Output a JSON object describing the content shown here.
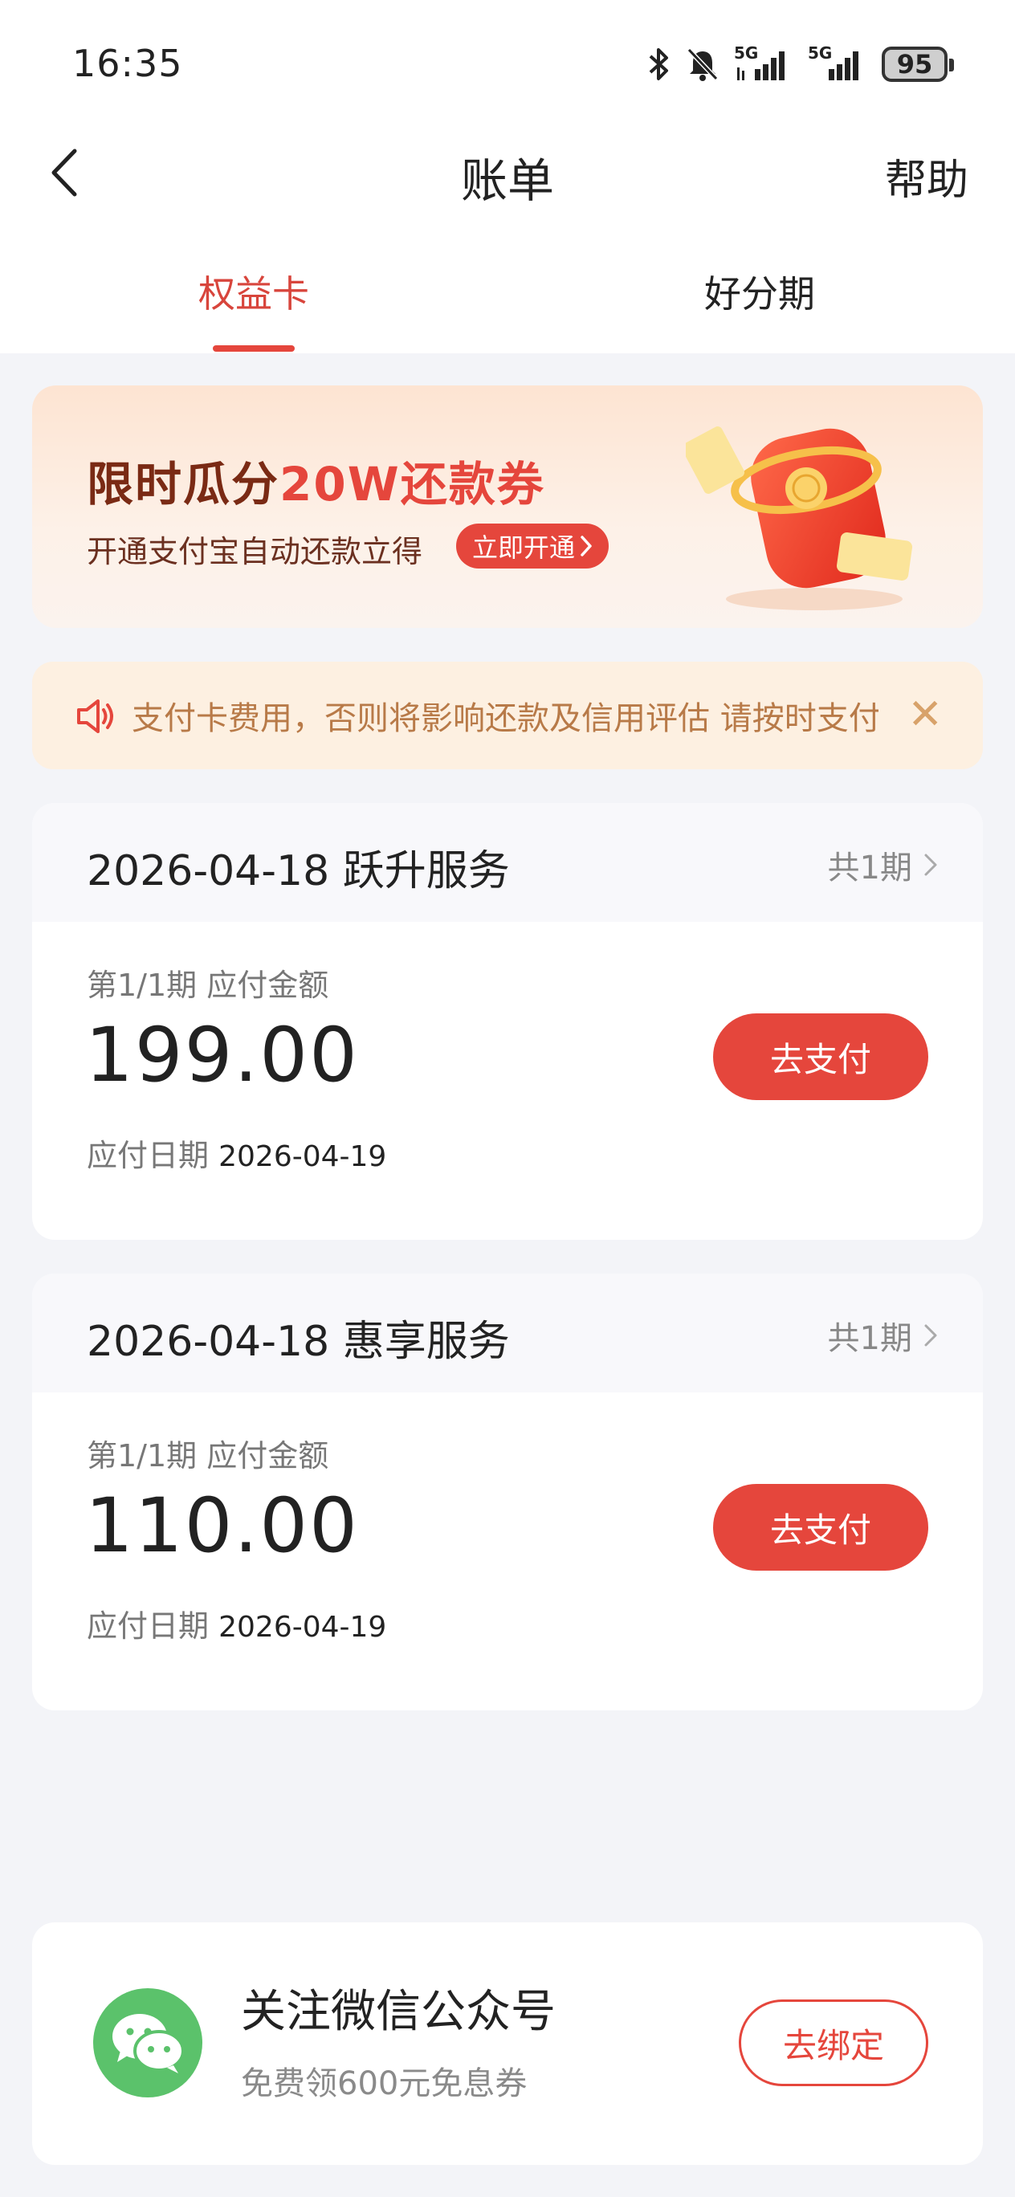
{
  "status_bar": {
    "time": "16:35",
    "network_1": "5G",
    "network_2": "5G",
    "battery": "95",
    "icons": [
      "bluetooth-icon",
      "mute-icon",
      "signal-icon",
      "signal-icon",
      "battery-icon"
    ]
  },
  "nav": {
    "title": "账单",
    "help": "帮助",
    "back_icon": "chevron-left-icon"
  },
  "tabs": [
    {
      "label": "权益卡",
      "active": true
    },
    {
      "label": "好分期",
      "active": false
    }
  ],
  "promo": {
    "title_main": "限时瓜分",
    "title_highlight": "20W还款券",
    "subtitle": "开通支付宝自动还款立得",
    "cta": "立即开通"
  },
  "notice": {
    "text": "支付卡费用，否则将影响还款及信用评估        请按时支付",
    "icon": "speaker-icon",
    "close_icon": "close-icon"
  },
  "bills": [
    {
      "title": "2026-04-18 跃升服务",
      "periods": "共1期",
      "label": "第1/1期 应付金额",
      "amount": "199.00",
      "due_label": "应付日期",
      "due_date": "2026-04-19",
      "pay_label": "去支付"
    },
    {
      "title": "2026-04-18 惠享服务",
      "periods": "共1期",
      "label": "第1/1期 应付金额",
      "amount": "110.00",
      "due_label": "应付日期",
      "due_date": "2026-04-19",
      "pay_label": "去支付"
    }
  ],
  "wechat": {
    "title": "关注微信公众号",
    "subtitle": "免费领600元免息券",
    "bind_label": "去绑定",
    "icon": "wechat-icon"
  },
  "colors": {
    "accent": "#e5463c",
    "background": "#f3f4f8",
    "notice_bg": "#fdf0e1",
    "wechat_green": "#5bc26b"
  }
}
